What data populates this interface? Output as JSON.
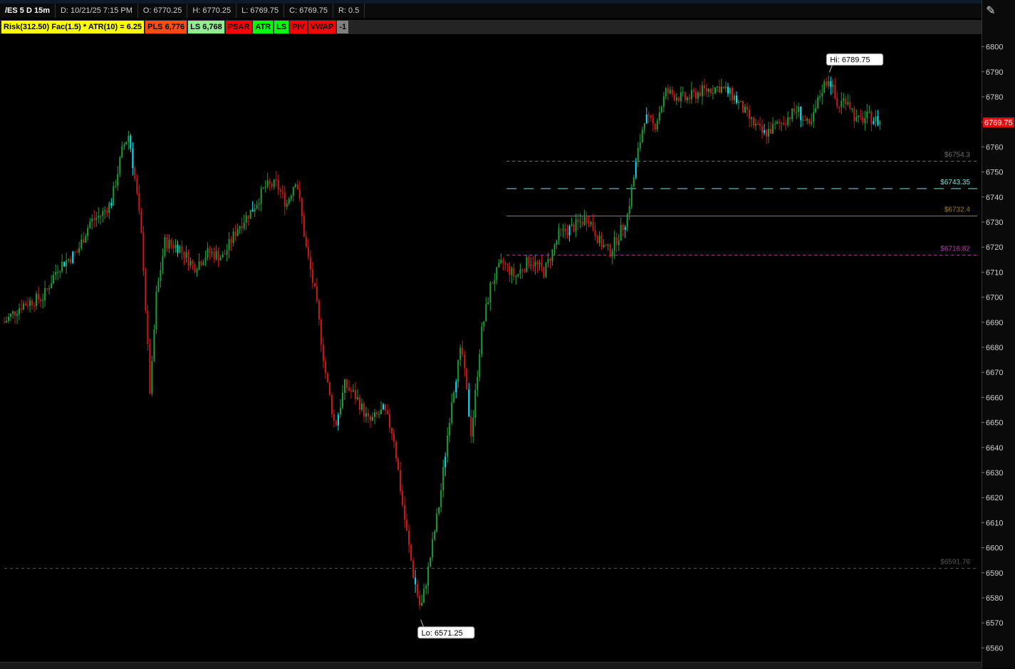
{
  "header": {
    "symbol": "/ES 5 D 15m",
    "date": "D: 10/21/25 7:15 PM",
    "open": "O: 6770.25",
    "high": "H: 6770.25",
    "low": "L: 6769.75",
    "close": "C: 6769.75",
    "range": "R: 0.5"
  },
  "studies": [
    {
      "label": "Risk(312.50) Fac(1.5) * ATR(10) = 6.25",
      "bg": "#ffff00",
      "fg": "#000000"
    },
    {
      "label": "PLS 6,776",
      "bg": "#ff4a10",
      "fg": "#000000"
    },
    {
      "label": "LS 6,768",
      "bg": "#90ee90",
      "fg": "#000000"
    },
    {
      "label": "PSAR",
      "bg": "#ff0000",
      "fg": "#000000"
    },
    {
      "label": "ATR",
      "bg": "#00ff00",
      "fg": "#000000"
    },
    {
      "label": "LS",
      "bg": "#00ff00",
      "fg": "#000000"
    },
    {
      "label": "PIV",
      "bg": "#ff0000",
      "fg": "#000000"
    },
    {
      "label": "VWAP",
      "bg": "#ff0000",
      "fg": "#000000"
    },
    {
      "label": "-1",
      "bg": "#808080",
      "fg": "#000000"
    }
  ],
  "colors": {
    "up": "#1e9e3a",
    "down": "#d01818",
    "highlight": "#00e5ff",
    "current_price_bg": "#e01010"
  },
  "chart_data": {
    "type": "candlestick",
    "ylim": [
      6555,
      6805
    ],
    "yticks": [
      6800,
      6790,
      6780,
      6770,
      6760,
      6750,
      6740,
      6730,
      6720,
      6710,
      6700,
      6690,
      6680,
      6670,
      6660,
      6650,
      6640,
      6630,
      6620,
      6610,
      6600,
      6590,
      6580,
      6570,
      6560
    ],
    "current_price": {
      "value": 6769.75,
      "label": "6769.75"
    },
    "high_label": {
      "text": "Hi: 6789.75",
      "value": 6789.75
    },
    "low_label": {
      "text": "Lo: 6571.25",
      "value": 6571.25
    },
    "levels": [
      {
        "value": 6754.3,
        "label": "$6754.3",
        "color": "#707070",
        "style": "dashed",
        "session_from": 0.465
      },
      {
        "value": 6743.35,
        "label": "$6743.35",
        "color": "#7fe0e0",
        "style": "longdash",
        "session_from": 0.465
      },
      {
        "value": 6732.4,
        "label": "$6732.4",
        "color": "#9a7d2a",
        "style": "solid",
        "session_from": 0.465
      },
      {
        "value": 6716.82,
        "label": "$6716.82",
        "color": "#b040b0",
        "style": "dashed",
        "session_from": 0.465
      },
      {
        "value": 6591.76,
        "label": "$6591.76",
        "color": "#555555",
        "style": "dashed",
        "session_from": 0.0
      }
    ],
    "path": [
      [
        0.0,
        6690
      ],
      [
        0.018,
        6697
      ],
      [
        0.04,
        6700
      ],
      [
        0.055,
        6712
      ],
      [
        0.075,
        6718
      ],
      [
        0.088,
        6730
      ],
      [
        0.1,
        6733
      ],
      [
        0.11,
        6738
      ],
      [
        0.122,
        6760
      ],
      [
        0.128,
        6765
      ],
      [
        0.136,
        6742
      ],
      [
        0.142,
        6720
      ],
      [
        0.15,
        6660
      ],
      [
        0.156,
        6700
      ],
      [
        0.165,
        6722
      ],
      [
        0.18,
        6720
      ],
      [
        0.195,
        6712
      ],
      [
        0.21,
        6718
      ],
      [
        0.225,
        6716
      ],
      [
        0.24,
        6728
      ],
      [
        0.255,
        6735
      ],
      [
        0.268,
        6744
      ],
      [
        0.28,
        6745
      ],
      [
        0.29,
        6737
      ],
      [
        0.3,
        6748
      ],
      [
        0.31,
        6720
      ],
      [
        0.32,
        6700
      ],
      [
        0.33,
        6670
      ],
      [
        0.34,
        6648
      ],
      [
        0.35,
        6665
      ],
      [
        0.362,
        6660
      ],
      [
        0.375,
        6650
      ],
      [
        0.39,
        6655
      ],
      [
        0.4,
        6645
      ],
      [
        0.41,
        6615
      ],
      [
        0.42,
        6590
      ],
      [
        0.428,
        6575
      ],
      [
        0.436,
        6592
      ],
      [
        0.448,
        6620
      ],
      [
        0.46,
        6660
      ],
      [
        0.47,
        6680
      ],
      [
        0.48,
        6645
      ],
      [
        0.49,
        6685
      ],
      [
        0.5,
        6705
      ],
      [
        0.512,
        6714
      ],
      [
        0.525,
        6708
      ],
      [
        0.54,
        6715
      ],
      [
        0.555,
        6710
      ],
      [
        0.57,
        6725
      ],
      [
        0.585,
        6728
      ],
      [
        0.6,
        6732
      ],
      [
        0.612,
        6722
      ],
      [
        0.622,
        6718
      ],
      [
        0.632,
        6725
      ],
      [
        0.64,
        6732
      ],
      [
        0.65,
        6755
      ],
      [
        0.658,
        6772
      ],
      [
        0.668,
        6768
      ],
      [
        0.68,
        6782
      ],
      [
        0.7,
        6779
      ],
      [
        0.715,
        6782
      ],
      [
        0.735,
        6784
      ],
      [
        0.75,
        6780
      ],
      [
        0.768,
        6770
      ],
      [
        0.78,
        6765
      ],
      [
        0.8,
        6770
      ],
      [
        0.815,
        6775
      ],
      [
        0.828,
        6767
      ],
      [
        0.84,
        6783
      ],
      [
        0.848,
        6788
      ],
      [
        0.856,
        6776
      ],
      [
        0.866,
        6780
      ],
      [
        0.876,
        6770
      ],
      [
        0.888,
        6772
      ],
      [
        0.9,
        6770
      ]
    ]
  }
}
